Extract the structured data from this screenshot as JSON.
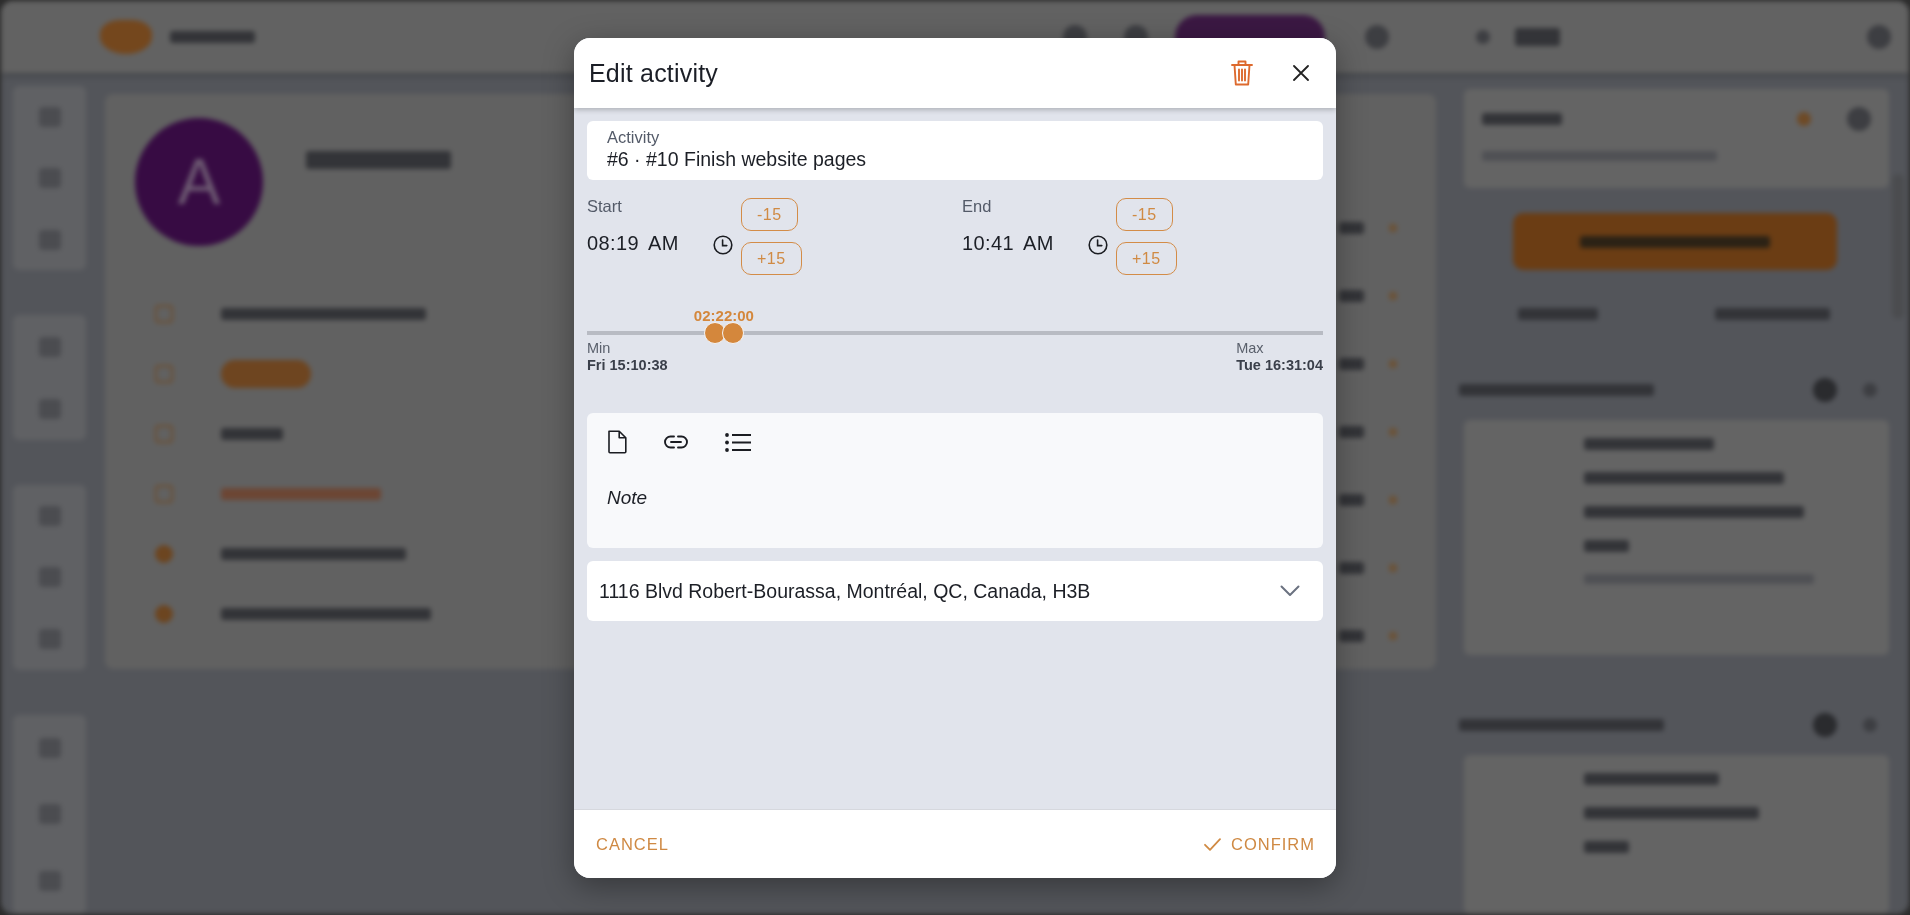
{
  "dialog": {
    "title": "Edit activity"
  },
  "activity_field": {
    "label": "Activity",
    "value": "#6 · #10 Finish website pages"
  },
  "time_fields": [
    {
      "label": "Start",
      "value": "08:19 AM",
      "steps": [
        "-15",
        "+15"
      ]
    },
    {
      "label": "End",
      "value": "10:41 AM",
      "steps": [
        "-15",
        "+15"
      ]
    }
  ],
  "range_slider": {
    "value_label": "02:22:00",
    "thumbs": [
      {
        "level": 0.174
      },
      {
        "level": 0.198
      }
    ],
    "min": {
      "label": "Min",
      "value": "Fri 15:10:38"
    },
    "max": {
      "label": "Max",
      "value": "Tue 16:31:04"
    }
  },
  "note_editor": {
    "placeholder": "Note"
  },
  "address_select": {
    "value": "1116 Blvd Robert-Bourassa, Montréal, QC, Canada, H3B"
  },
  "footer_buttons": [
    {
      "label": "CANCEL",
      "kind": "plain"
    },
    {
      "label": "CONFIRM",
      "kind": "confirm"
    }
  ],
  "background": {
    "avatar_initial": "A"
  }
}
